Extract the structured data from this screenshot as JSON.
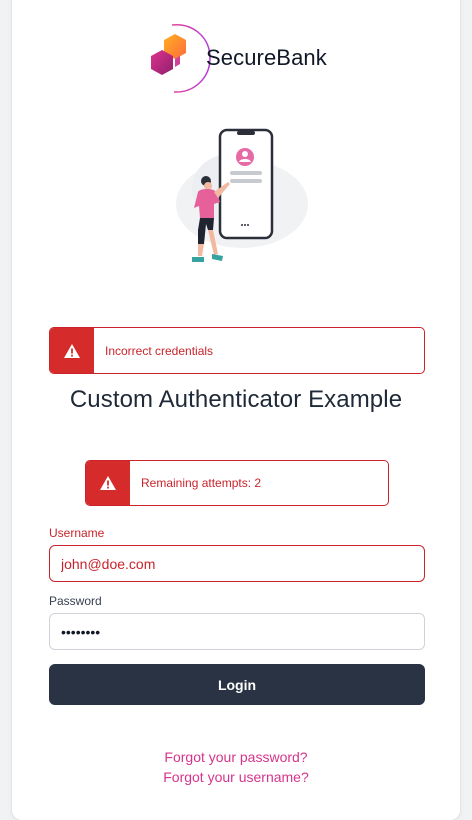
{
  "brand": {
    "name": "SecureBank",
    "colors": {
      "accent": "#d6348c",
      "error": "#c9242b",
      "button": "#2a3344"
    }
  },
  "alerts": {
    "credentials": {
      "icon": "warning-icon",
      "message": "Incorrect credentials"
    },
    "attempts": {
      "icon": "warning-icon",
      "message": "Remaining attempts: 2"
    }
  },
  "page": {
    "title": "Custom Authenticator Example"
  },
  "form": {
    "username_label": "Username",
    "username_value": "john@doe.com",
    "password_label": "Password",
    "password_value": "••••••••",
    "login_label": "Login"
  },
  "links": {
    "forgot_password": "Forgot your password?",
    "forgot_username": "Forgot your username?"
  }
}
